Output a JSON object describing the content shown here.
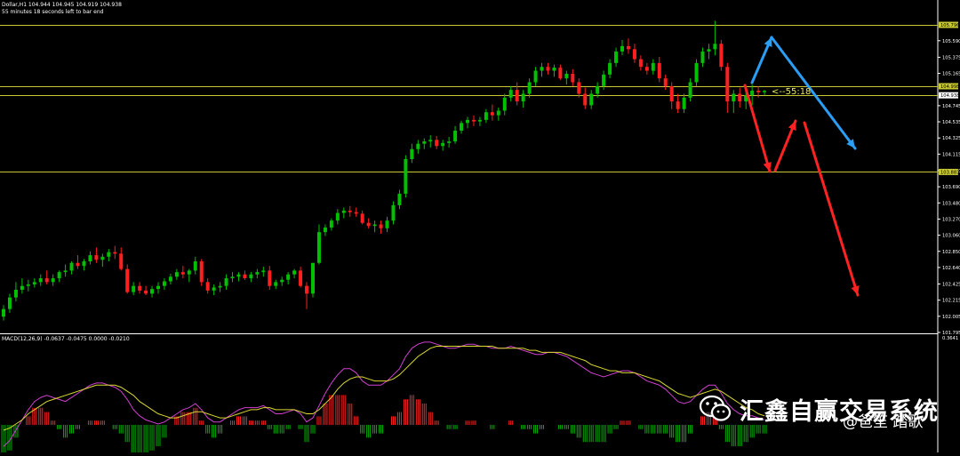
{
  "header": {
    "symbol_line": "Dollar,H1  104.944 104.945 104.919 104.938",
    "countdown_line": "55 minutes 18 seconds left to bar end"
  },
  "macd_header": "MACD(12,26,9) -0.0637 -0.0475 0.0000 -0.0210",
  "timer_label": "<--55:18",
  "watermark": {
    "title": "汇鑫自赢交易系统",
    "author": "@爸笙 踏歌"
  },
  "colors": {
    "background": "#000000",
    "bull": "#00c000",
    "bear": "#ff1f1f",
    "hline": "#c8c832",
    "macd_line": "#d040d0",
    "signal_line": "#d8d830",
    "hist_pos": "#ff2020",
    "hist_neg": "#00b000",
    "arrow_blue": "#2a9df4",
    "arrow_red": "#ff2222",
    "timer_text": "#e8e860"
  },
  "chart_data": [
    {
      "type": "candlestick",
      "title": "Dollar,H1",
      "ylim": [
        101.795,
        105.9
      ],
      "y_ticks": [
        "105.590",
        "105.375",
        "105.165",
        "104.745",
        "104.535",
        "104.325",
        "104.115",
        "103.900",
        "103.690",
        "103.480",
        "103.270",
        "103.060",
        "102.850",
        "102.640",
        "102.425",
        "102.215",
        "102.005",
        "101.795"
      ],
      "price_labels": [
        {
          "text": "105.796",
          "value": 105.796
        },
        {
          "text": "104.998",
          "value": 104.998
        },
        {
          "text": "104.938",
          "value": 104.88
        },
        {
          "text": "103.883",
          "value": 103.883
        }
      ],
      "horizontal_lines": [
        105.796,
        104.998,
        104.88,
        103.883
      ],
      "candles": [
        [
          102.0,
          102.15,
          101.95,
          102.1
        ],
        [
          102.1,
          102.3,
          102.05,
          102.25
        ],
        [
          102.25,
          102.45,
          102.2,
          102.35
        ],
        [
          102.35,
          102.5,
          102.3,
          102.4
        ],
        [
          102.4,
          102.48,
          102.33,
          102.42
        ],
        [
          102.42,
          102.5,
          102.38,
          102.45
        ],
        [
          102.45,
          102.55,
          102.4,
          102.5
        ],
        [
          102.5,
          102.6,
          102.42,
          102.45
        ],
        [
          102.45,
          102.55,
          102.4,
          102.5
        ],
        [
          102.5,
          102.6,
          102.45,
          102.58
        ],
        [
          102.58,
          102.68,
          102.52,
          102.6
        ],
        [
          102.6,
          102.72,
          102.55,
          102.7
        ],
        [
          102.7,
          102.8,
          102.62,
          102.66
        ],
        [
          102.66,
          102.75,
          102.6,
          102.72
        ],
        [
          102.72,
          102.85,
          102.68,
          102.8
        ],
        [
          102.8,
          102.9,
          102.7,
          102.74
        ],
        [
          102.74,
          102.82,
          102.65,
          102.78
        ],
        [
          102.78,
          102.88,
          102.72,
          102.84
        ],
        [
          102.84,
          102.92,
          102.75,
          102.82
        ],
        [
          102.82,
          102.9,
          102.6,
          102.62
        ],
        [
          102.62,
          102.68,
          102.3,
          102.32
        ],
        [
          102.32,
          102.45,
          102.28,
          102.4
        ],
        [
          102.4,
          102.45,
          102.3,
          102.34
        ],
        [
          102.34,
          102.4,
          102.28,
          102.3
        ],
        [
          102.3,
          102.4,
          102.25,
          102.36
        ],
        [
          102.36,
          102.45,
          102.3,
          102.4
        ],
        [
          102.4,
          102.5,
          102.35,
          102.46
        ],
        [
          102.46,
          102.56,
          102.42,
          102.52
        ],
        [
          102.52,
          102.62,
          102.48,
          102.58
        ],
        [
          102.58,
          102.66,
          102.5,
          102.55
        ],
        [
          102.55,
          102.62,
          102.45,
          102.6
        ],
        [
          102.6,
          102.78,
          102.55,
          102.72
        ],
        [
          102.72,
          102.75,
          102.4,
          102.45
        ],
        [
          102.45,
          102.5,
          102.3,
          102.34
        ],
        [
          102.34,
          102.42,
          102.28,
          102.38
        ],
        [
          102.38,
          102.45,
          102.32,
          102.4
        ],
        [
          102.4,
          102.55,
          102.35,
          102.5
        ],
        [
          102.5,
          102.58,
          102.45,
          102.52
        ],
        [
          102.52,
          102.58,
          102.46,
          102.55
        ],
        [
          102.55,
          102.6,
          102.48,
          102.5
        ],
        [
          102.5,
          102.58,
          102.45,
          102.55
        ],
        [
          102.55,
          102.62,
          102.5,
          102.58
        ],
        [
          102.58,
          102.65,
          102.52,
          102.6
        ],
        [
          102.6,
          102.66,
          102.35,
          102.4
        ],
        [
          102.4,
          102.48,
          102.36,
          102.45
        ],
        [
          102.45,
          102.52,
          102.4,
          102.48
        ],
        [
          102.48,
          102.58,
          102.42,
          102.55
        ],
        [
          102.55,
          102.62,
          102.5,
          102.6
        ],
        [
          102.6,
          102.65,
          102.38,
          102.4
        ],
        [
          102.4,
          102.45,
          102.1,
          102.3
        ],
        [
          102.3,
          102.5,
          102.25,
          102.7
        ],
        [
          102.7,
          103.2,
          102.68,
          103.1
        ],
        [
          103.1,
          103.2,
          103.05,
          103.16
        ],
        [
          103.16,
          103.28,
          103.12,
          103.25
        ],
        [
          103.25,
          103.4,
          103.2,
          103.35
        ],
        [
          103.35,
          103.42,
          103.28,
          103.38
        ],
        [
          103.38,
          103.44,
          103.3,
          103.36
        ],
        [
          103.36,
          103.42,
          103.3,
          103.34
        ],
        [
          103.34,
          103.38,
          103.2,
          103.22
        ],
        [
          103.22,
          103.28,
          103.15,
          103.18
        ],
        [
          103.18,
          103.25,
          103.1,
          103.2
        ],
        [
          103.2,
          103.25,
          103.08,
          103.15
        ],
        [
          103.15,
          103.3,
          103.1,
          103.25
        ],
        [
          103.25,
          103.5,
          103.2,
          103.45
        ],
        [
          103.45,
          103.65,
          103.4,
          103.6
        ],
        [
          103.6,
          104.1,
          103.55,
          104.05
        ],
        [
          104.05,
          104.25,
          104.0,
          104.18
        ],
        [
          104.18,
          104.3,
          104.12,
          104.25
        ],
        [
          104.25,
          104.32,
          104.18,
          104.28
        ],
        [
          104.28,
          104.36,
          104.2,
          104.3
        ],
        [
          104.3,
          104.35,
          104.18,
          104.22
        ],
        [
          104.22,
          104.3,
          104.16,
          104.26
        ],
        [
          104.26,
          104.34,
          104.2,
          104.28
        ],
        [
          104.28,
          104.48,
          104.25,
          104.42
        ],
        [
          104.42,
          104.55,
          104.38,
          104.52
        ],
        [
          104.52,
          104.6,
          104.45,
          104.56
        ],
        [
          104.56,
          104.62,
          104.48,
          104.54
        ],
        [
          104.54,
          104.6,
          104.48,
          104.56
        ],
        [
          104.56,
          104.7,
          104.52,
          104.66
        ],
        [
          104.66,
          104.76,
          104.55,
          104.62
        ],
        [
          104.62,
          104.72,
          104.55,
          104.68
        ],
        [
          104.68,
          104.9,
          104.62,
          104.85
        ],
        [
          104.85,
          105.0,
          104.8,
          104.95
        ],
        [
          104.95,
          105.05,
          104.75,
          104.8
        ],
        [
          104.8,
          104.95,
          104.72,
          104.9
        ],
        [
          104.9,
          105.1,
          104.85,
          105.05
        ],
        [
          105.05,
          105.25,
          105.0,
          105.2
        ],
        [
          105.2,
          105.3,
          105.12,
          105.25
        ],
        [
          105.25,
          105.3,
          105.15,
          105.2
        ],
        [
          105.2,
          105.28,
          105.12,
          105.24
        ],
        [
          105.24,
          105.28,
          105.08,
          105.1
        ],
        [
          105.1,
          105.2,
          105.02,
          105.16
        ],
        [
          105.16,
          105.22,
          105.0,
          105.05
        ],
        [
          105.05,
          105.1,
          104.85,
          104.9
        ],
        [
          104.9,
          104.98,
          104.7,
          104.75
        ],
        [
          104.75,
          104.95,
          104.7,
          104.9
        ],
        [
          104.9,
          105.05,
          104.85,
          105.0
        ],
        [
          105.0,
          105.2,
          104.95,
          105.15
        ],
        [
          105.15,
          105.35,
          105.1,
          105.3
        ],
        [
          105.3,
          105.5,
          105.25,
          105.45
        ],
        [
          105.45,
          105.6,
          105.4,
          105.52
        ],
        [
          105.52,
          105.62,
          105.42,
          105.48
        ],
        [
          105.48,
          105.55,
          105.3,
          105.35
        ],
        [
          105.35,
          105.4,
          105.2,
          105.25
        ],
        [
          105.25,
          105.3,
          105.15,
          105.2
        ],
        [
          105.2,
          105.35,
          105.15,
          105.3
        ],
        [
          105.3,
          105.38,
          105.05,
          105.1
        ],
        [
          105.1,
          105.15,
          104.95,
          105.0
        ],
        [
          105.0,
          105.05,
          104.7,
          104.8
        ],
        [
          104.8,
          104.9,
          104.65,
          104.7
        ],
        [
          104.7,
          104.9,
          104.65,
          104.85
        ],
        [
          104.85,
          105.1,
          104.8,
          105.05
        ],
        [
          105.05,
          105.35,
          105.0,
          105.3
        ],
        [
          105.3,
          105.5,
          105.25,
          105.45
        ],
        [
          105.45,
          105.55,
          105.35,
          105.48
        ],
        [
          105.48,
          105.85,
          105.4,
          105.55
        ],
        [
          105.55,
          105.6,
          105.2,
          105.25
        ],
        [
          105.25,
          105.3,
          104.65,
          104.8
        ],
        [
          104.8,
          104.95,
          104.65,
          104.9
        ],
        [
          104.9,
          104.98,
          104.72,
          104.8
        ],
        [
          104.8,
          104.92,
          104.7,
          104.88
        ],
        [
          104.88,
          105.02,
          104.75,
          104.94
        ],
        [
          104.94,
          105.0,
          104.85,
          104.92
        ],
        [
          104.92,
          104.95,
          104.88,
          104.938
        ]
      ]
    },
    {
      "type": "macd",
      "title": "MACD(12,26,9)",
      "ylim": [
        -0.2,
        0.3641
      ],
      "y_ticks": [
        "0.3641"
      ],
      "macd": [
        -0.18,
        -0.15,
        -0.1,
        -0.05,
        0.0,
        0.04,
        0.06,
        0.07,
        0.06,
        0.05,
        0.04,
        0.06,
        0.08,
        0.1,
        0.12,
        0.13,
        0.13,
        0.12,
        0.11,
        0.09,
        0.05,
        0.0,
        -0.03,
        -0.05,
        -0.06,
        -0.07,
        -0.06,
        -0.04,
        -0.02,
        0.0,
        0.01,
        0.03,
        0.0,
        -0.04,
        -0.06,
        -0.06,
        -0.04,
        -0.02,
        0.0,
        0.01,
        0.01,
        0.01,
        0.02,
        0.0,
        -0.02,
        -0.02,
        -0.01,
        0.0,
        -0.02,
        -0.06,
        -0.04,
        0.02,
        0.08,
        0.13,
        0.17,
        0.2,
        0.2,
        0.18,
        0.14,
        0.12,
        0.12,
        0.12,
        0.14,
        0.17,
        0.2,
        0.26,
        0.3,
        0.32,
        0.33,
        0.33,
        0.32,
        0.31,
        0.3,
        0.3,
        0.31,
        0.32,
        0.32,
        0.31,
        0.31,
        0.3,
        0.3,
        0.3,
        0.31,
        0.3,
        0.29,
        0.28,
        0.27,
        0.27,
        0.28,
        0.28,
        0.27,
        0.26,
        0.24,
        0.22,
        0.2,
        0.18,
        0.17,
        0.16,
        0.17,
        0.18,
        0.19,
        0.19,
        0.18,
        0.16,
        0.14,
        0.13,
        0.12,
        0.1,
        0.07,
        0.04,
        0.03,
        0.04,
        0.07,
        0.1,
        0.12,
        0.12,
        0.08,
        0.03,
        0.0,
        -0.02,
        -0.03,
        -0.03,
        -0.04,
        -0.05
      ],
      "signal": [
        -0.1,
        -0.09,
        -0.07,
        -0.05,
        -0.02,
        0.0,
        0.02,
        0.04,
        0.05,
        0.06,
        0.07,
        0.08,
        0.09,
        0.1,
        0.11,
        0.12,
        0.12,
        0.12,
        0.12,
        0.11,
        0.09,
        0.07,
        0.04,
        0.02,
        0.0,
        -0.02,
        -0.03,
        -0.04,
        -0.04,
        -0.03,
        -0.02,
        -0.01,
        -0.01,
        -0.02,
        -0.03,
        -0.04,
        -0.04,
        -0.03,
        -0.02,
        -0.01,
        0.0,
        0.0,
        0.01,
        0.01,
        0.0,
        0.0,
        0.0,
        0.0,
        -0.01,
        -0.02,
        -0.02,
        0.0,
        0.03,
        0.06,
        0.1,
        0.13,
        0.15,
        0.16,
        0.16,
        0.15,
        0.14,
        0.14,
        0.14,
        0.15,
        0.17,
        0.2,
        0.23,
        0.26,
        0.28,
        0.3,
        0.31,
        0.31,
        0.31,
        0.31,
        0.31,
        0.31,
        0.31,
        0.31,
        0.31,
        0.31,
        0.3,
        0.3,
        0.3,
        0.3,
        0.3,
        0.29,
        0.29,
        0.28,
        0.28,
        0.28,
        0.28,
        0.27,
        0.26,
        0.25,
        0.24,
        0.22,
        0.21,
        0.2,
        0.19,
        0.19,
        0.18,
        0.18,
        0.18,
        0.17,
        0.16,
        0.15,
        0.14,
        0.12,
        0.1,
        0.08,
        0.07,
        0.06,
        0.07,
        0.08,
        0.09,
        0.1,
        0.09,
        0.07,
        0.05,
        0.03,
        0.01,
        0.0,
        -0.02,
        -0.03
      ]
    }
  ],
  "arrows": [
    {
      "color": "blue",
      "from": [
        846,
        93
      ],
      "to": [
        868,
        42
      ]
    },
    {
      "color": "blue",
      "from": [
        868,
        42
      ],
      "to": [
        962,
        167
      ]
    },
    {
      "color": "red",
      "from": [
        838,
        96
      ],
      "to": [
        866,
        193
      ]
    },
    {
      "color": "red",
      "from": [
        872,
        192
      ],
      "to": [
        895,
        136
      ]
    },
    {
      "color": "red",
      "from": [
        905,
        138
      ],
      "to": [
        965,
        332
      ]
    }
  ]
}
